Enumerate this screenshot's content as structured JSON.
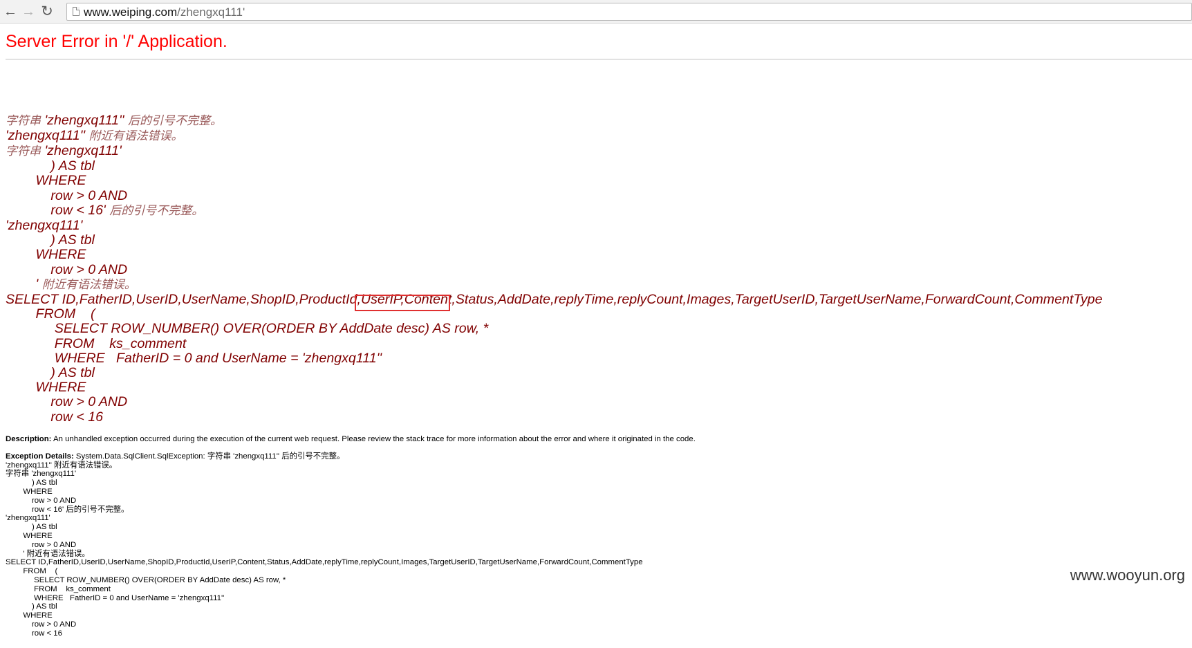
{
  "browser": {
    "url_host": "www.weiping.com",
    "url_path": "/zhengxq111'",
    "back_icon": "back-arrow-icon",
    "forward_icon": "forward-arrow-icon",
    "reload_icon": "reload-icon",
    "page_icon": "page-icon"
  },
  "page": {
    "title": "Server Error in '/' Application.",
    "message_lines": [
      "字符串 'zhengxq111'' 后的引号不完整。",
      "'zhengxq111'' 附近有语法错误。",
      "字符串 'zhengxq111'",
      "            ) AS tbl",
      "        WHERE",
      "            row > 0 AND",
      "            row < 16' 后的引号不完整。",
      "'zhengxq111'",
      "            ) AS tbl",
      "        WHERE",
      "            row > 0 AND",
      "        ' 附近有语法错误。",
      "SELECT ID,FatherID,UserID,UserName,ShopID,ProductId,UserIP,Content,Status,AddDate,replyTime,replyCount,Images,TargetUserID,TargetUserName,ForwardCount,CommentType",
      "        FROM    (",
      "             SELECT ROW_NUMBER() OVER(ORDER BY AddDate desc) AS row, *",
      "             FROM    ks_comment",
      "             WHERE   FatherID = 0 and UserName = 'zhengxq111''",
      "            ) AS tbl",
      "        WHERE",
      "            row > 0 AND",
      "            row < 16"
    ],
    "description_label": "Description:",
    "description_text": " An unhandled exception occurred during the execution of the current web request. Please review the stack trace for more information about the error and where it originated in the code.",
    "exception_label": "Exception Details:",
    "exception_text": " System.Data.SqlClient.SqlException: 字符串 'zhengxq111'' 后的引号不完整。\n'zhengxq111'' 附近有语法错误。\n字符串 'zhengxq111'\n            ) AS tbl\n        WHERE\n            row > 0 AND\n            row < 16' 后的引号不完整。\n'zhengxq111'\n            ) AS tbl\n        WHERE\n            row > 0 AND\n        ' 附近有语法错误。\nSELECT ID,FatherID,UserID,UserName,ShopID,ProductId,UserIP,Content,Status,AddDate,replyTime,replyCount,Images,TargetUserID,TargetUserName,ForwardCount,CommentType\n        FROM    (\n             SELECT ROW_NUMBER() OVER(ORDER BY AddDate desc) AS row, *\n             FROM    ks_comment\n             WHERE   FatherID = 0 and UserName = 'zhengxq111''\n            ) AS tbl\n        WHERE\n            row > 0 AND\n            row < 16"
  },
  "watermark": "www.wooyun.org",
  "colors": {
    "title": "#ff0000",
    "message": "#800000",
    "highlight": "#e03030"
  }
}
